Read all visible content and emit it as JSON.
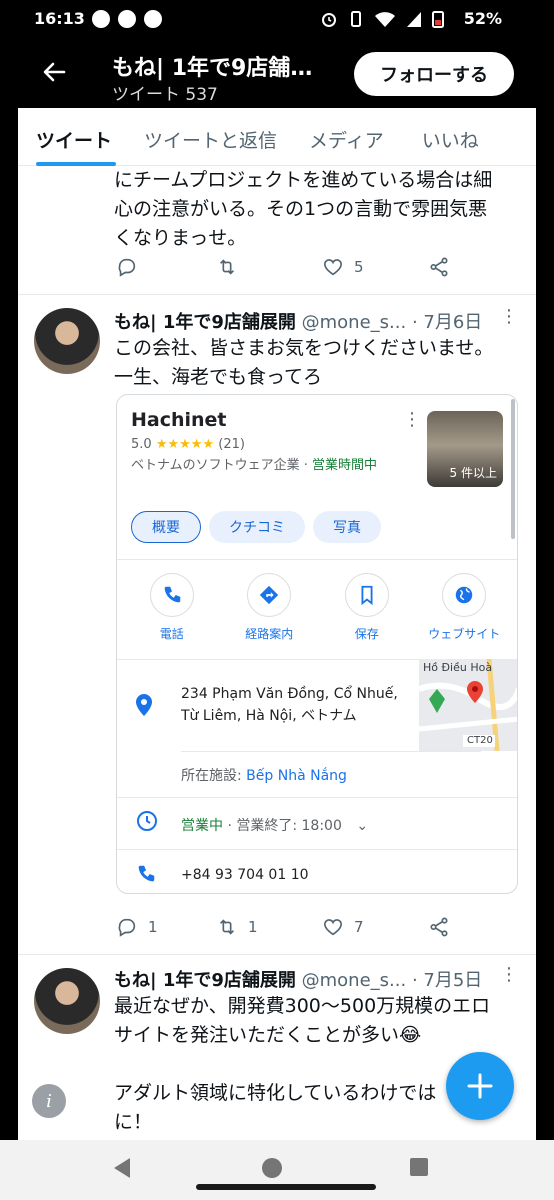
{
  "status_bar": {
    "time": "16:13",
    "battery": "52%"
  },
  "header": {
    "name": "もね| 1年で9店舗展開",
    "tweet_count": "ツイート 537",
    "follow_label": "フォローする"
  },
  "tabs": [
    {
      "label": "ツイート"
    },
    {
      "label": "ツイートと返信"
    },
    {
      "label": "メディア"
    },
    {
      "label": "いいね"
    }
  ],
  "tweets": [
    {
      "text_lines": [
        "にチームプロジェクトを進めている場合は細",
        "心の注意がいる。その1つの言動で雰囲気悪",
        "くなりまっせ。"
      ],
      "reply_count": "",
      "retweet_count": "",
      "like_count": "5"
    },
    {
      "name": "もね| 1年で9店舗展開",
      "handle": "@mone_s...",
      "date": "· 7月6日",
      "text_lines": [
        "この会社、皆さまお気をつけくださいませ。",
        "一生、海老でも食ってろ"
      ],
      "reply_count": "1",
      "retweet_count": "1",
      "like_count": "7",
      "card": {
        "business_name": "Hachinet",
        "rating": "5.0",
        "stars": "★★★★★",
        "review_count": "(21)",
        "category": "ベトナムのソフトウェア企業",
        "status_short": "営業時間中",
        "photo_count": "5 件以上",
        "chips": [
          "概要",
          "クチコミ",
          "写真"
        ],
        "buttons": [
          {
            "label": "電話"
          },
          {
            "label": "経路案内"
          },
          {
            "label": "保存"
          },
          {
            "label": "ウェブサイト"
          }
        ],
        "address": "234 Phạm Văn Đồng, Cổ Nhuế, Từ Liêm, Hà Nội, ベトナム",
        "located_in_label": "所在施設: ",
        "located_in_value": "Bếp Nhà Nắng",
        "hours_open": "営業中",
        "hours_close": " · 営業終了: 18:00",
        "phone": "+84 93 704 01 10",
        "map_label": "Hồ Điều Hoà",
        "map_road": "CT20"
      }
    },
    {
      "name": "もね| 1年で9店舗展開",
      "handle": "@mone_s...",
      "date": "· 7月5日",
      "text_lines": [
        "最近なぜか、開発費300〜500万規模のエロ",
        "サイトを発注いただくことが多い😂",
        "",
        "アダルト領域に特化しているわけでは",
        "に！"
      ]
    }
  ],
  "colors": {
    "accent": "#1d9bf0",
    "maps_blue": "#1a73e8",
    "open_green": "#188038"
  }
}
